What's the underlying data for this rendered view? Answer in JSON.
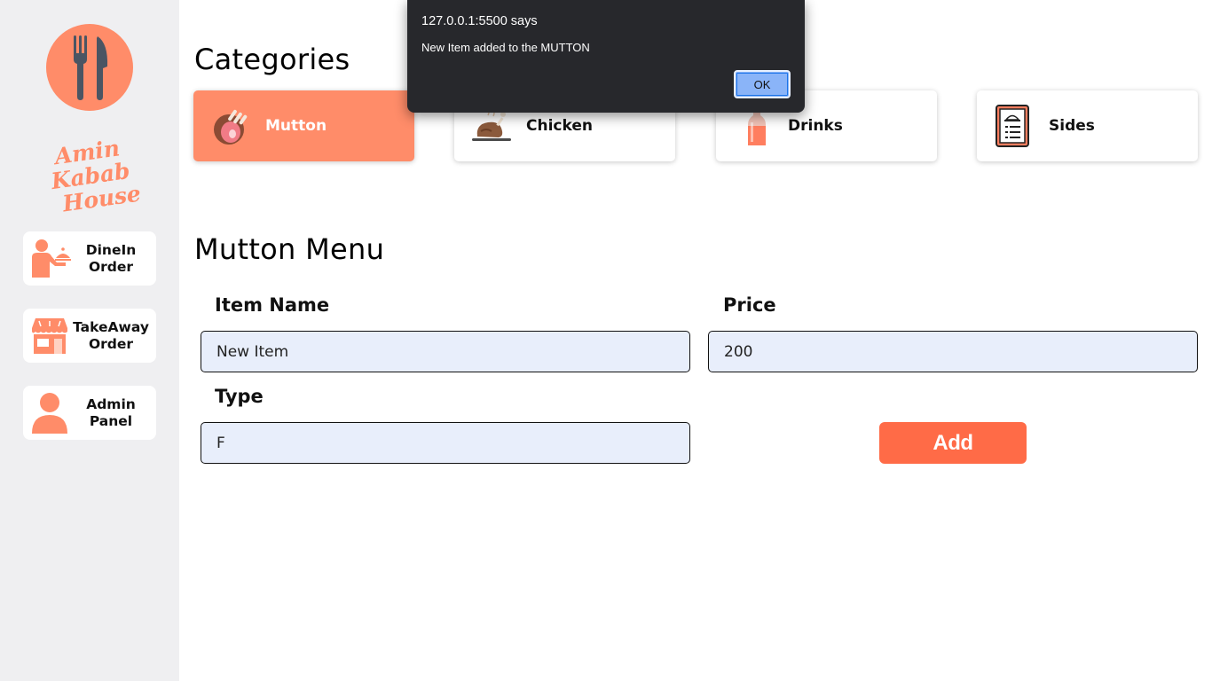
{
  "brand": {
    "line1": "Amin Kabab",
    "line2": "House",
    "color": "#ff8c69"
  },
  "sidebar": {
    "items": [
      {
        "label": "DineIn\nOrder",
        "icon": "waiter-icon"
      },
      {
        "label": "TakeAway\nOrder",
        "icon": "store-icon"
      },
      {
        "label": "Admin\nPanel",
        "icon": "user-icon"
      }
    ]
  },
  "categories": {
    "title": "Categories",
    "items": [
      {
        "label": "Mutton",
        "icon": "mutton-icon",
        "active": true
      },
      {
        "label": "Chicken",
        "icon": "chicken-icon",
        "active": false
      },
      {
        "label": "Drinks",
        "icon": "drink-bottle-icon",
        "active": false
      },
      {
        "label": "Sides",
        "icon": "menu-card-icon",
        "active": false
      }
    ]
  },
  "menu": {
    "title": "Mutton Menu",
    "item_name_label": "Item Name",
    "item_name_value": "New Item",
    "price_label": "Price",
    "price_value": "200",
    "type_label": "Type",
    "type_value": "F",
    "add_label": "Add"
  },
  "alert": {
    "title": "127.0.0.1:5500 says",
    "message": "New Item added to the MUTTON",
    "ok_label": "OK"
  },
  "colors": {
    "accent": "#ff8c69",
    "button": "#ff6b47",
    "input_bg": "#e8eefb",
    "sidebar_bg": "#efeff1"
  }
}
